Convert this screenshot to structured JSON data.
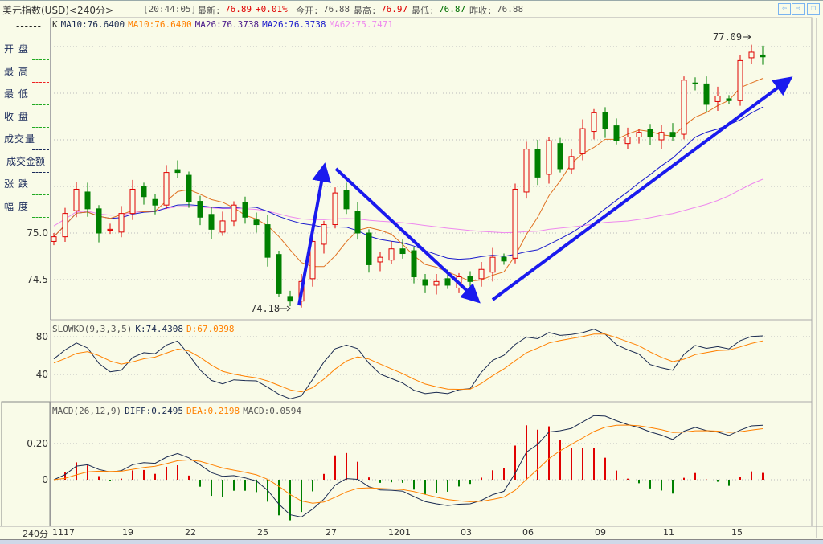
{
  "header": {
    "title": "美元指数(USD)<240分>",
    "time": "[20:44:05]",
    "latest_label": "最新:",
    "latest": "76.89",
    "change": "+0.01%",
    "open_label": "今开:",
    "open": "76.88",
    "high_label": "最高:",
    "high": "76.97",
    "low_label": "最低:",
    "low": "76.87",
    "prev_label": "昨收:",
    "prev": "76.88",
    "nav": {
      "prev": "⇦",
      "next": "⇨",
      "restore": "❐"
    }
  },
  "left_panel": {
    "dashes": "------",
    "items": [
      "开 盘",
      "最 高",
      "最 低",
      "收 盘",
      "成交量",
      "成交金额",
      "涨 跌",
      "幅 度"
    ]
  },
  "main_legend": {
    "k": "K",
    "ma10a": "MA10:76.6400",
    "ma10b": "MA10:76.6400",
    "ma26a": "MA26:76.3738",
    "ma26b": "MA26:76.3738",
    "ma62": "MA62:75.7471"
  },
  "kd_legend": {
    "name": "SLOWKD(9,3,3,5)",
    "k": "K:74.4308",
    "d": "D:67.0398"
  },
  "macd_legend": {
    "name": "MACD(26,12,9)",
    "diff": "DIFF:0.2495",
    "dea": "DEA:0.2198",
    "macd": "MACD:0.0594"
  },
  "annotations": {
    "low_mark": "74.18",
    "high_mark": "77.09"
  },
  "axis": {
    "price_ticks": [
      "75.0",
      "74.5"
    ],
    "kd_ticks": [
      "80",
      "40"
    ],
    "macd_ticks": [
      "0.20",
      "0"
    ],
    "period": "240分",
    "x_ticks": [
      "1117",
      "19",
      "22",
      "25",
      "27",
      "1201",
      "03",
      "06",
      "09",
      "11",
      "15"
    ]
  },
  "colors": {
    "up": "#e00000",
    "down": "#008000",
    "ma_short": "#e07020",
    "ma_mid": "#1a1acc",
    "ma_long": "#ee88ee",
    "k_line": "#1a2a50",
    "d_line": "#ff8000",
    "arrow": "#1a1aee"
  },
  "chart_data": {
    "type": "candlestick",
    "title": "美元指数(USD) 240分",
    "ylim": [
      74.1,
      77.2
    ],
    "closes": [
      74.96,
      75.21,
      75.47,
      75.26,
      75.0,
      75.04,
      75.21,
      75.47,
      75.39,
      75.3,
      75.65,
      75.65,
      75.34,
      75.17,
      75.04,
      75.13,
      75.3,
      75.17,
      75.09,
      74.74,
      74.35,
      74.27,
      74.48,
      74.91,
      75.09,
      75.43,
      75.26,
      75.0,
      74.66,
      74.74,
      74.83,
      74.78,
      74.53,
      74.44,
      74.48,
      74.44,
      74.53,
      74.48,
      74.61,
      74.74,
      74.7,
      75.47,
      75.9,
      75.6,
      75.99,
      75.69,
      75.82,
      76.12,
      76.29,
      76.12,
      75.99,
      76.03,
      76.08,
      76.03,
      76.08,
      76.03,
      76.64,
      76.6,
      76.38,
      76.47,
      76.42,
      76.85,
      76.94,
      76.89
    ]
  }
}
